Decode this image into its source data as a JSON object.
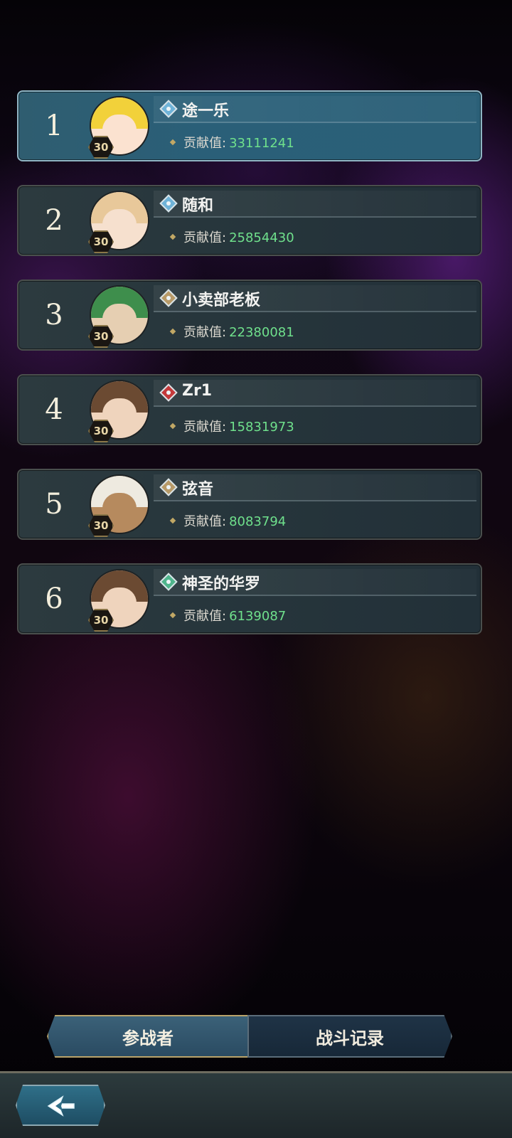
{
  "contribution_label": "贡献值:",
  "rows": [
    {
      "rank": "1",
      "name": "途一乐",
      "level": "30",
      "value": "33111241",
      "element_color": "#6fb3d8",
      "hair_color": "#f2d13a",
      "skin_color": "#fbe2d0",
      "highlight": true
    },
    {
      "rank": "2",
      "name": "随和",
      "level": "30",
      "value": "25854430",
      "element_color": "#6fb3d8",
      "hair_color": "#e8c89a",
      "skin_color": "#f6e0ce",
      "highlight": false
    },
    {
      "rank": "3",
      "name": "小卖部老板",
      "level": "30",
      "value": "22380081",
      "element_color": "#b89a68",
      "hair_color": "#3e8e4c",
      "skin_color": "#e6cfb2",
      "highlight": false
    },
    {
      "rank": "4",
      "name": "Zr1",
      "level": "30",
      "value": "15831973",
      "element_color": "#c4393b",
      "hair_color": "#6b4a32",
      "skin_color": "#efd4bd",
      "highlight": false
    },
    {
      "rank": "5",
      "name": "弦音",
      "level": "30",
      "value": "8083794",
      "element_color": "#b89a68",
      "hair_color": "#eeeae0",
      "skin_color": "#b68a5e",
      "highlight": false
    },
    {
      "rank": "6",
      "name": "神圣的华罗",
      "level": "30",
      "value": "6139087",
      "element_color": "#4fb58c",
      "hair_color": "#6b4a32",
      "skin_color": "#efd4bd",
      "highlight": false
    }
  ],
  "tabs": {
    "participants": "参战者",
    "battle_log": "战斗记录"
  },
  "icons": {
    "back": "back-arrow-icon"
  }
}
